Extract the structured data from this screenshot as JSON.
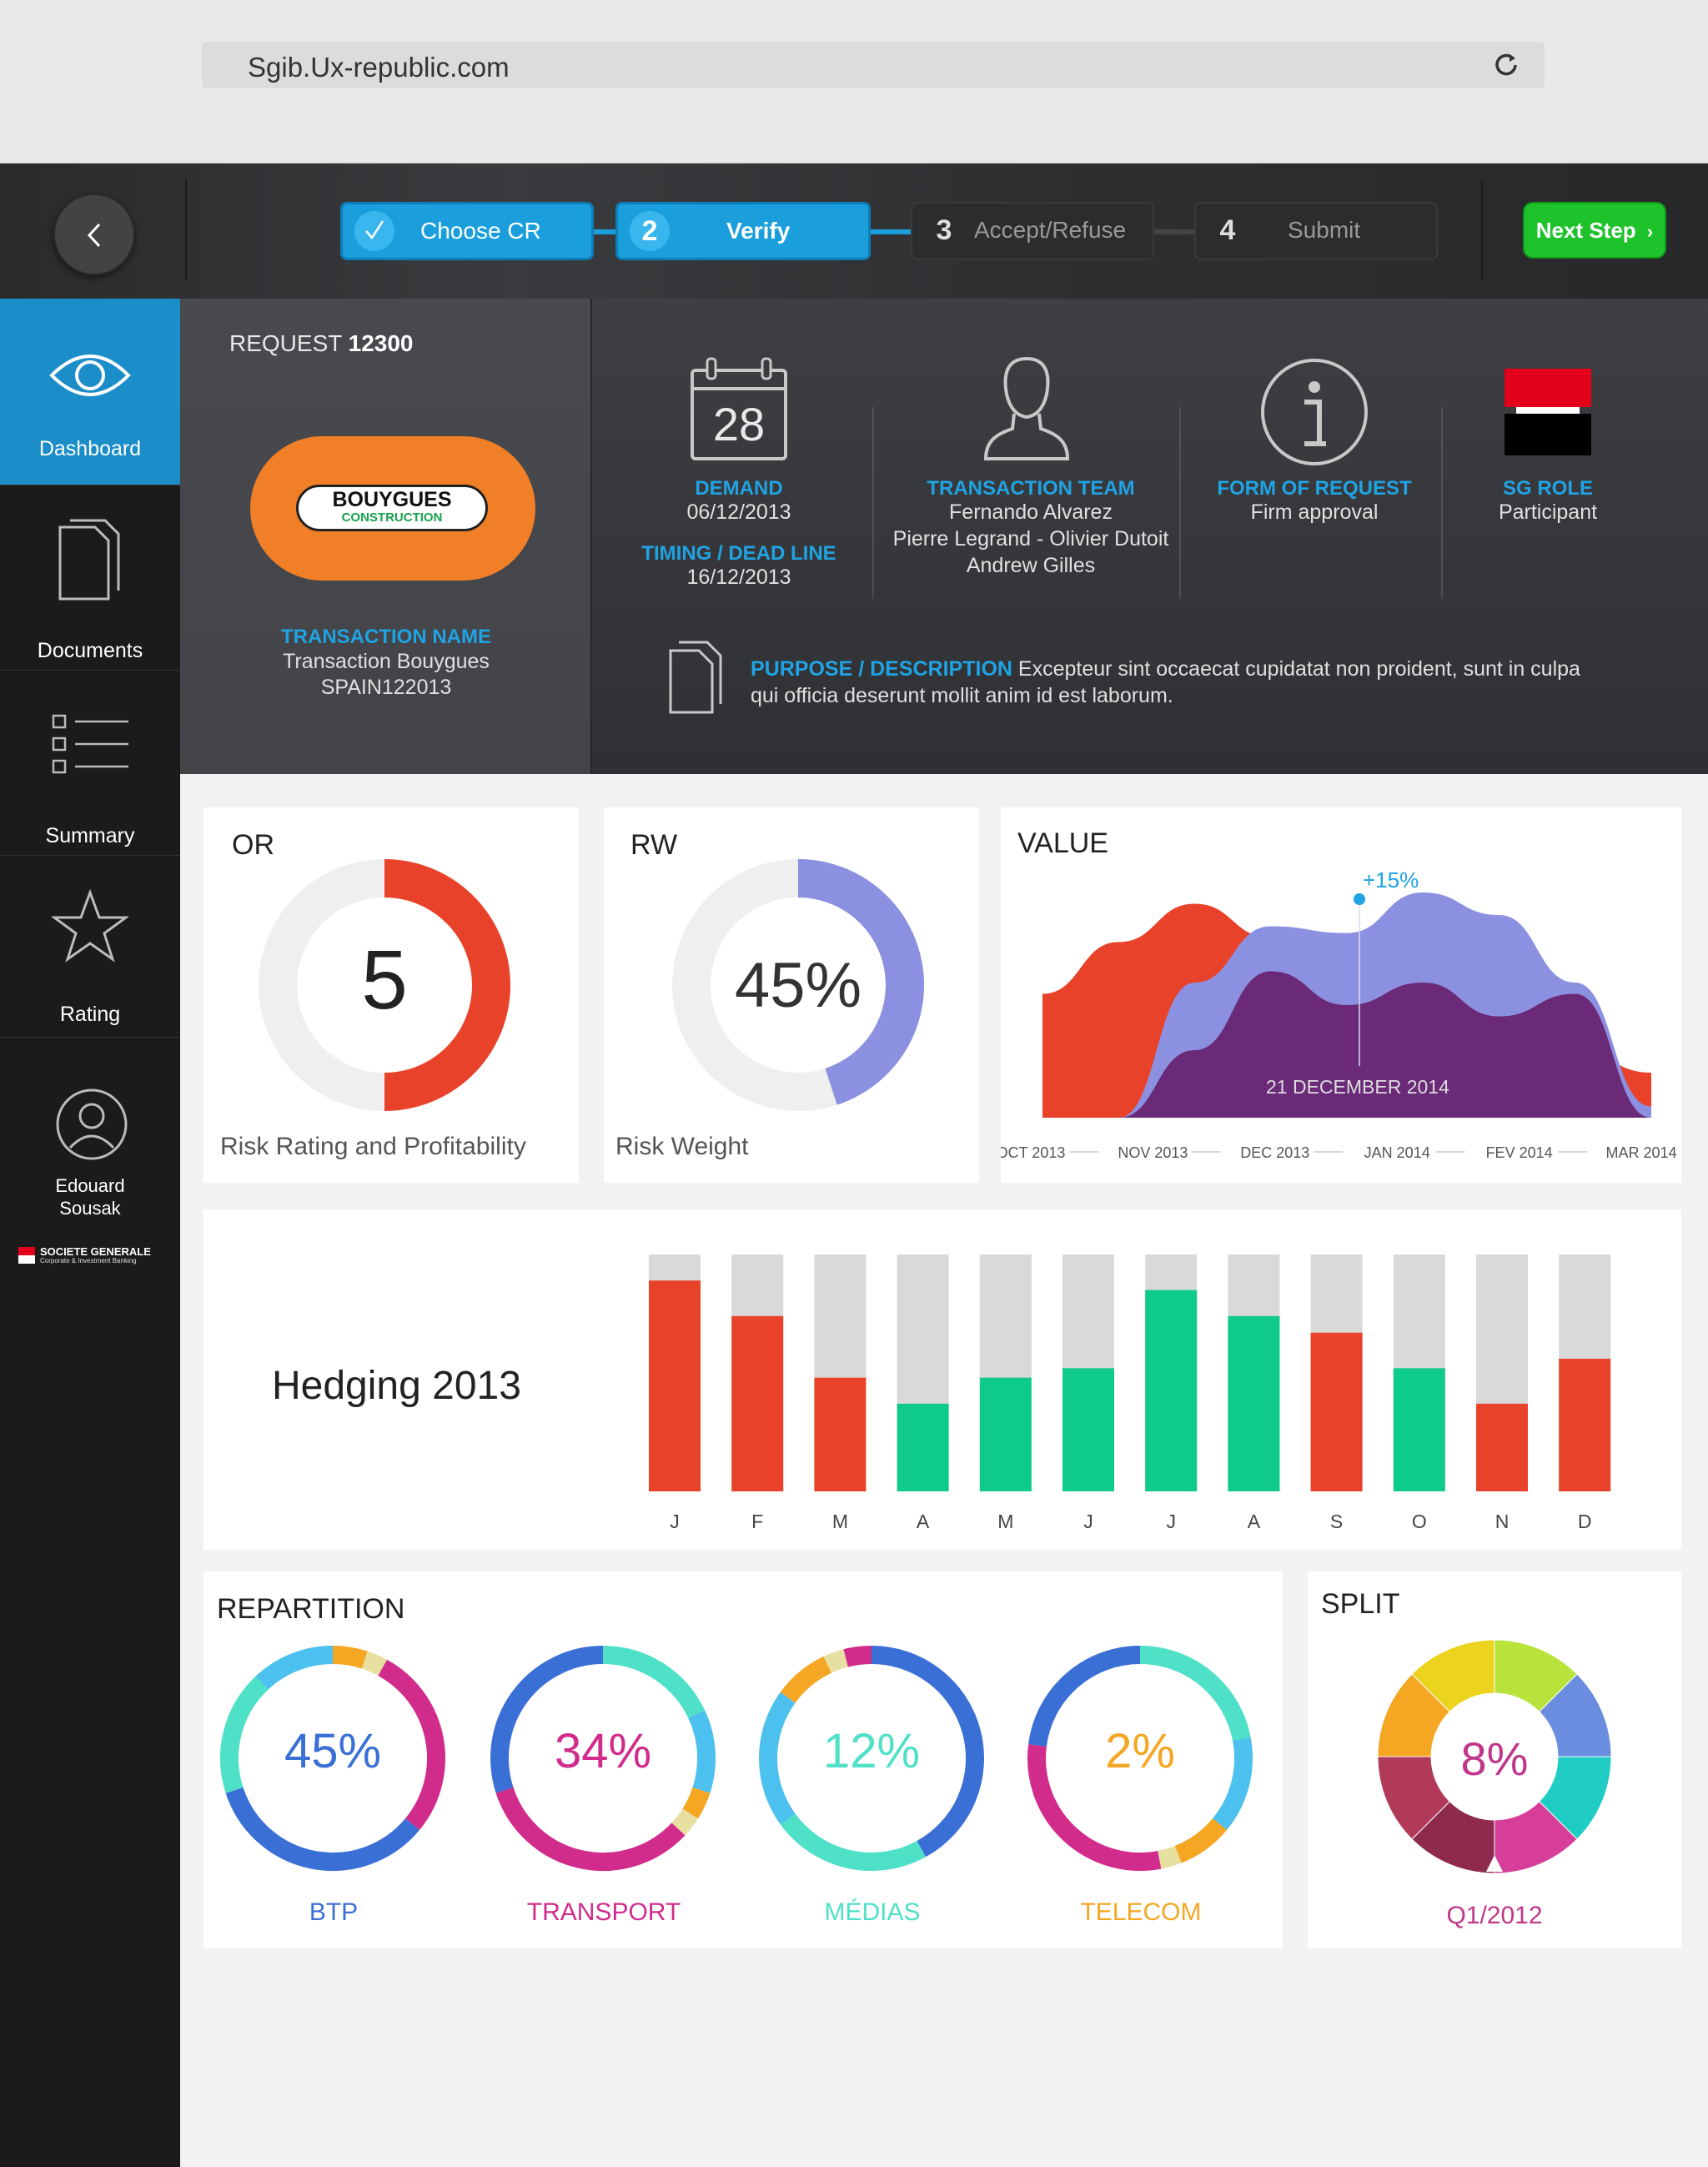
{
  "browser": {
    "url": "Sgib.Ux-republic.com"
  },
  "wizard": {
    "steps": [
      {
        "num": "",
        "label": "Choose CR",
        "state": "done"
      },
      {
        "num": "2",
        "label": "Verify",
        "state": "active"
      },
      {
        "num": "3",
        "label": "Accept/Refuse",
        "state": "todo"
      },
      {
        "num": "4",
        "label": "Submit",
        "state": "todo"
      }
    ],
    "next_label": "Next Step"
  },
  "sidebar": {
    "items": [
      {
        "label": "Dashboard",
        "icon": "eye-icon",
        "active": true
      },
      {
        "label": "Documents",
        "icon": "documents-icon",
        "active": false
      },
      {
        "label": "Summary",
        "icon": "list-icon",
        "active": false
      },
      {
        "label": "Rating",
        "icon": "star-icon",
        "active": false
      }
    ],
    "user": {
      "first": "Edouard",
      "last": "Sousak"
    },
    "brand_l1": "SOCIETE GENERALE",
    "brand_l2": "Corporate & Investment Banking"
  },
  "request": {
    "title_prefix": "REQUEST",
    "number": "12300",
    "logo_l1": "BOUYGUES",
    "logo_l2": "CONSTRUCTION",
    "transaction_name_label": "TRANSACTION NAME",
    "transaction_name_l1": "Transaction Bouygues",
    "transaction_name_l2": "SPAIN122013",
    "calendar_day": "28",
    "demand_label": "DEMAND",
    "demand_value": "06/12/2013",
    "deadline_label": "TIMING / DEAD LINE",
    "deadline_value": "16/12/2013",
    "team_label": "TRANSACTION TEAM",
    "team_l1": "Fernando Alvarez",
    "team_l2": "Pierre Legrand - Olivier Dutoit",
    "team_l3": "Andrew Gilles",
    "form_label": "FORM OF REQUEST",
    "form_value": "Firm approval",
    "role_label": "SG ROLE",
    "role_value": "Participant",
    "purpose_label": "PURPOSE / DESCRIPTION",
    "purpose_l1": "Excepteur sint occaecat cupidatat non proident, sunt in culpa",
    "purpose_l2": "qui officia deserunt mollit anim id est laborum."
  },
  "colors": {
    "accent": "#1b9fdc",
    "red": "#e8432a",
    "green": "#0ecb8a",
    "violet": "#8c90e0",
    "purple": "#6b2a78",
    "next": "#1ec22b"
  },
  "or_card": {
    "title": "OR",
    "value": "5",
    "caption": "Risk Rating and Profitability",
    "fraction": 0.5
  },
  "rw_card": {
    "title": "RW",
    "value": "45%",
    "caption": "Risk Weight",
    "fraction": 0.45
  },
  "value_card": {
    "title": "VALUE",
    "annotation": "+15%",
    "date": "21 DECEMBER 2014"
  },
  "chart_data": [
    {
      "type": "area",
      "title": "VALUE",
      "x": [
        "OCT 2013",
        "NOV 2013",
        "DEC 2013",
        "JAN 2014",
        "FEV 2014",
        "MAR 2014"
      ],
      "series": [
        {
          "color": "#e8432a",
          "values": [
            55,
            78,
            95,
            80,
            70,
            60,
            65,
            30,
            20
          ]
        },
        {
          "color": "#8c90e0",
          "values": [
            0,
            0,
            60,
            85,
            82,
            100,
            90,
            60,
            5
          ]
        },
        {
          "color": "#6b2a78",
          "values": [
            0,
            0,
            30,
            65,
            50,
            60,
            45,
            55,
            0
          ]
        }
      ]
    },
    {
      "type": "bar",
      "title": "Hedging 2013",
      "categories": [
        "J",
        "F",
        "M",
        "A",
        "M",
        "J",
        "J",
        "A",
        "S",
        "O",
        "N",
        "D"
      ],
      "values": [
        89,
        74,
        48,
        37,
        48,
        52,
        85,
        74,
        67,
        52,
        37,
        56
      ],
      "colors": [
        "red",
        "red",
        "red",
        "green",
        "green",
        "green",
        "green",
        "green",
        "red",
        "green",
        "red",
        "red"
      ],
      "ylim": [
        0,
        100
      ]
    },
    {
      "type": "pie",
      "title": "REPARTITION",
      "categories": [
        "BTP",
        "TRANSPORT",
        "MÉDIAS",
        "TELECOM"
      ],
      "values": [
        45,
        34,
        12,
        2
      ],
      "labels": [
        "45%",
        "34%",
        "12%",
        "2%"
      ]
    },
    {
      "type": "pie",
      "title": "SPLIT",
      "center_value": "8%",
      "caption": "Q1/2012",
      "values": [
        12.5,
        12.5,
        12.5,
        12.5,
        12.5,
        12.5,
        12.5,
        12.5
      ]
    }
  ]
}
